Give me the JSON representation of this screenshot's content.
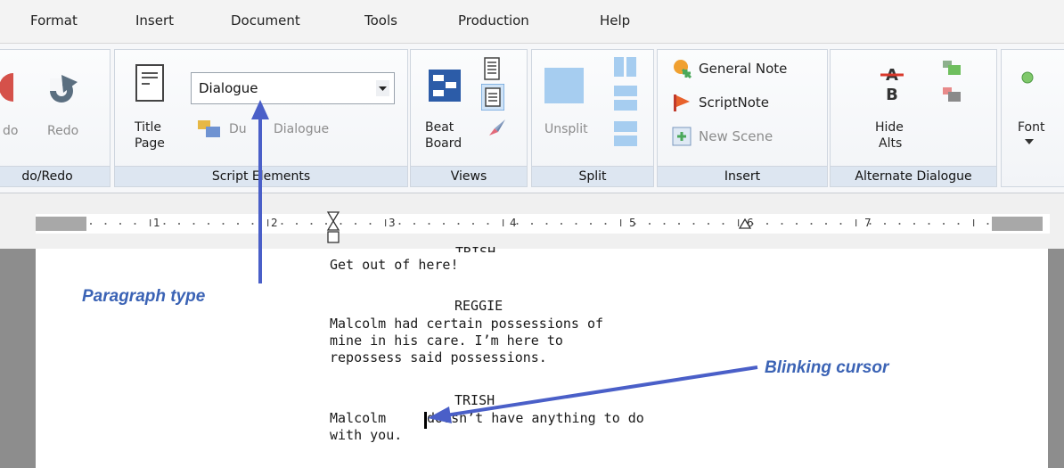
{
  "menu": [
    "Format",
    "Insert",
    "Document",
    "Tools",
    "Production",
    "Help"
  ],
  "ribbon": {
    "undo_label": "do",
    "redo_label": "Redo",
    "undo_redo_group": "do/Redo",
    "title_page_line1": "Title",
    "title_page_line2": "Page",
    "element_select": "Dialogue",
    "dual_dialogue_part1": "Du",
    "dual_dialogue_part2": "Dialogue",
    "script_elements_group": "Script Elements",
    "beat_board_line1": "Beat",
    "beat_board_line2": "Board",
    "views_group": "Views",
    "unsplit_label": "Unsplit",
    "split_group": "Split",
    "general_note": "General Note",
    "script_note": "ScriptNote",
    "new_scene": "New Scene",
    "insert_group": "Insert",
    "hide_alts_line1": "Hide",
    "hide_alts_line2": "Alts",
    "alternate_dialogue_group": "Alternate Dialogue",
    "font_label": "Font"
  },
  "ruler": {
    "numbers": [
      "1",
      "2",
      "3",
      "4",
      "5",
      "6",
      "7"
    ]
  },
  "script": {
    "char1_partial": "TRISH",
    "line1": "Get out of here!",
    "char2": "REGGIE",
    "line2a": "Malcolm had certain possessions of",
    "line2b": "mine in his care. I’m here to",
    "line2c": "repossess said possessions.",
    "char3": "TRISH",
    "line3a_before": "Malcolm ",
    "line3a_after": "doesn’t have anything to do",
    "line3b": "with you."
  },
  "annotations": {
    "paragraph_type": "Paragraph type",
    "blinking_cursor": "Blinking cursor"
  },
  "colors": {
    "annotation_blue": "#3b63b5",
    "arrow_blue": "#4a5fc8",
    "group_label_bg": "#dde6f1"
  },
  "icons": [
    "undo-icon",
    "redo-icon",
    "title-page-icon",
    "dropdown-arrow-icon",
    "dual-dialogue-icon",
    "beat-board-icon",
    "page-view-icon",
    "normal-view-icon",
    "rocket-icon",
    "unsplit-icon",
    "split-vertical-icon",
    "split-horizontal-icon",
    "general-note-icon",
    "scriptnote-icon",
    "new-scene-icon",
    "hide-alts-icon",
    "alt-dialogue-icon",
    "font-icon"
  ]
}
